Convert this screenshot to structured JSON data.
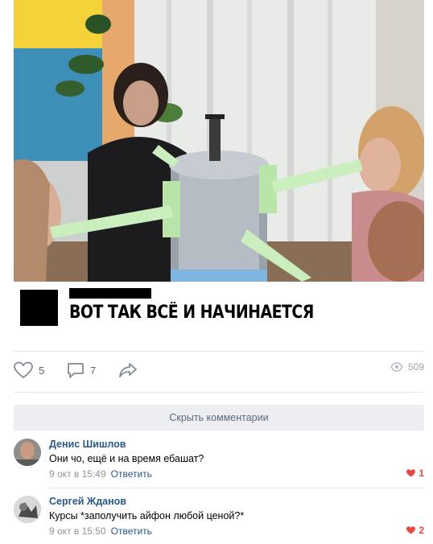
{
  "post": {
    "caption": "ВОТ ТАК ВСЁ И НАЧИНАЕТСЯ"
  },
  "actions": {
    "likes": "5",
    "comments": "7",
    "views": "509"
  },
  "hide_comments_label": "Скрыть комментарии",
  "comments": [
    {
      "author": "Денис Шишлов",
      "text": "Они чо, ещё и на время ебашат?",
      "time": "9 окт в 15:49",
      "reply": "Ответить",
      "likes": "1"
    },
    {
      "author": "Сергей Жданов",
      "text": "Курсы *заполучить айфон любой ценой?*",
      "time": "9 окт в 15:50",
      "reply": "Ответить",
      "likes": "2"
    }
  ],
  "colors": {
    "link": "#2a5885",
    "like_red": "#e64646",
    "button_bg": "#eceef2"
  }
}
